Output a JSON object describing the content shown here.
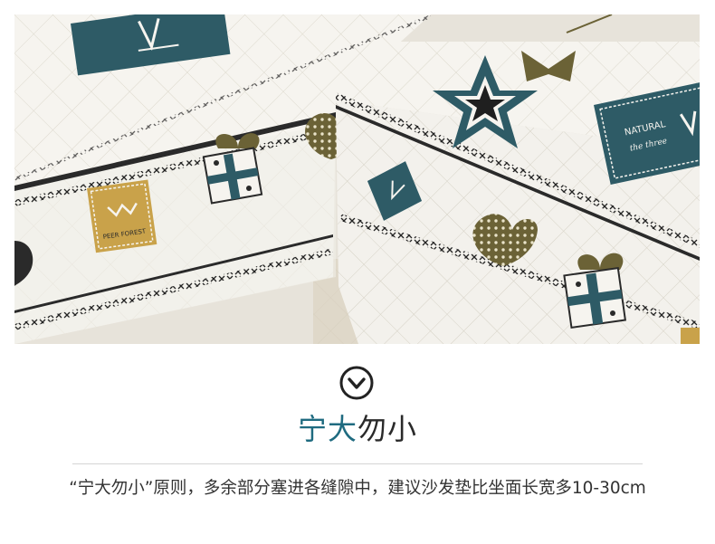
{
  "photo": {
    "alt": "Quilted sofa cushion covers with zebra stamp, star, heart and gift-box prints",
    "printed_text": {
      "stamp_left": "PEER FOREST",
      "stamp_right": "NATURAL",
      "stamp_right_sub": "the three"
    },
    "colors": {
      "fabric": "#f6f4ef",
      "teal": "#2e5b66",
      "olive": "#6b6236",
      "mustard": "#c9a24a",
      "stitch": "#222222",
      "base": "#d8cfbd"
    }
  },
  "icon": {
    "name": "chevron-down-circle"
  },
  "heading": {
    "accent": "宁大",
    "rest": "勿小"
  },
  "description": "“宁大勿小”原则，多余部分塞进各缝隙中，建议沙发垫比坐面长宽多10-30cm"
}
